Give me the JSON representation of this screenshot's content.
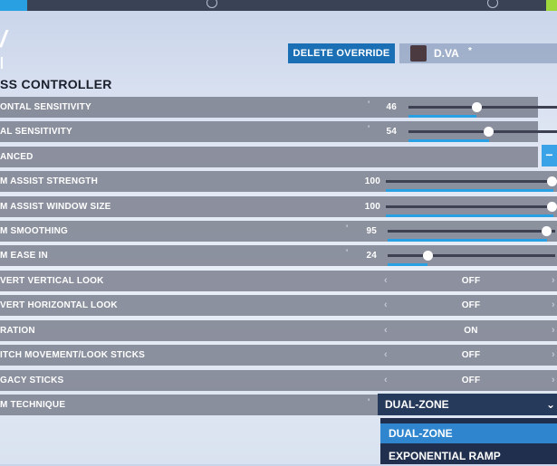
{
  "header": {
    "delete_override": "DELETE OVERRIDE",
    "hero_name": "D.VA",
    "hero_mark": "*"
  },
  "section_title": "SS CONTROLLER",
  "rows": [
    {
      "label": "ONTAL SENSITIVITY",
      "value": "46",
      "fraction": 0.46
    },
    {
      "label": "AL SENSITIVITY",
      "value": "54",
      "fraction": 0.54
    },
    {
      "label": "ANCED"
    },
    {
      "label": "M ASSIST STRENGTH",
      "value": "100",
      "fraction": 1.0
    },
    {
      "label": "M ASSIST WINDOW SIZE",
      "value": "100",
      "fraction": 1.0
    },
    {
      "label": "M SMOOTHING",
      "value": "95",
      "fraction": 0.95
    },
    {
      "label": "M EASE IN",
      "value": "24",
      "fraction": 0.24
    },
    {
      "label": "VERT VERTICAL LOOK",
      "value": "OFF"
    },
    {
      "label": "VERT HORIZONTAL LOOK",
      "value": "OFF"
    },
    {
      "label": "RATION",
      "value": "ON"
    },
    {
      "label": "ITCH MOVEMENT/LOOK STICKS",
      "value": "OFF"
    },
    {
      "label": "GACY STICKS",
      "value": "OFF"
    },
    {
      "label": "M TECHNIQUE"
    }
  ],
  "advanced_toggle": "−",
  "aim_technique": {
    "selected": "DUAL-ZONE",
    "options": [
      "DUAL-ZONE",
      "EXPONENTIAL RAMP"
    ]
  },
  "icons": {
    "left_arrow": "‹",
    "right_arrow": "›",
    "chevron": "⌄"
  },
  "colors": {
    "accent": "#29a0e2",
    "button": "#1a6fb5",
    "row_bg": "#696e7d",
    "dropdown": "#263a5b"
  }
}
